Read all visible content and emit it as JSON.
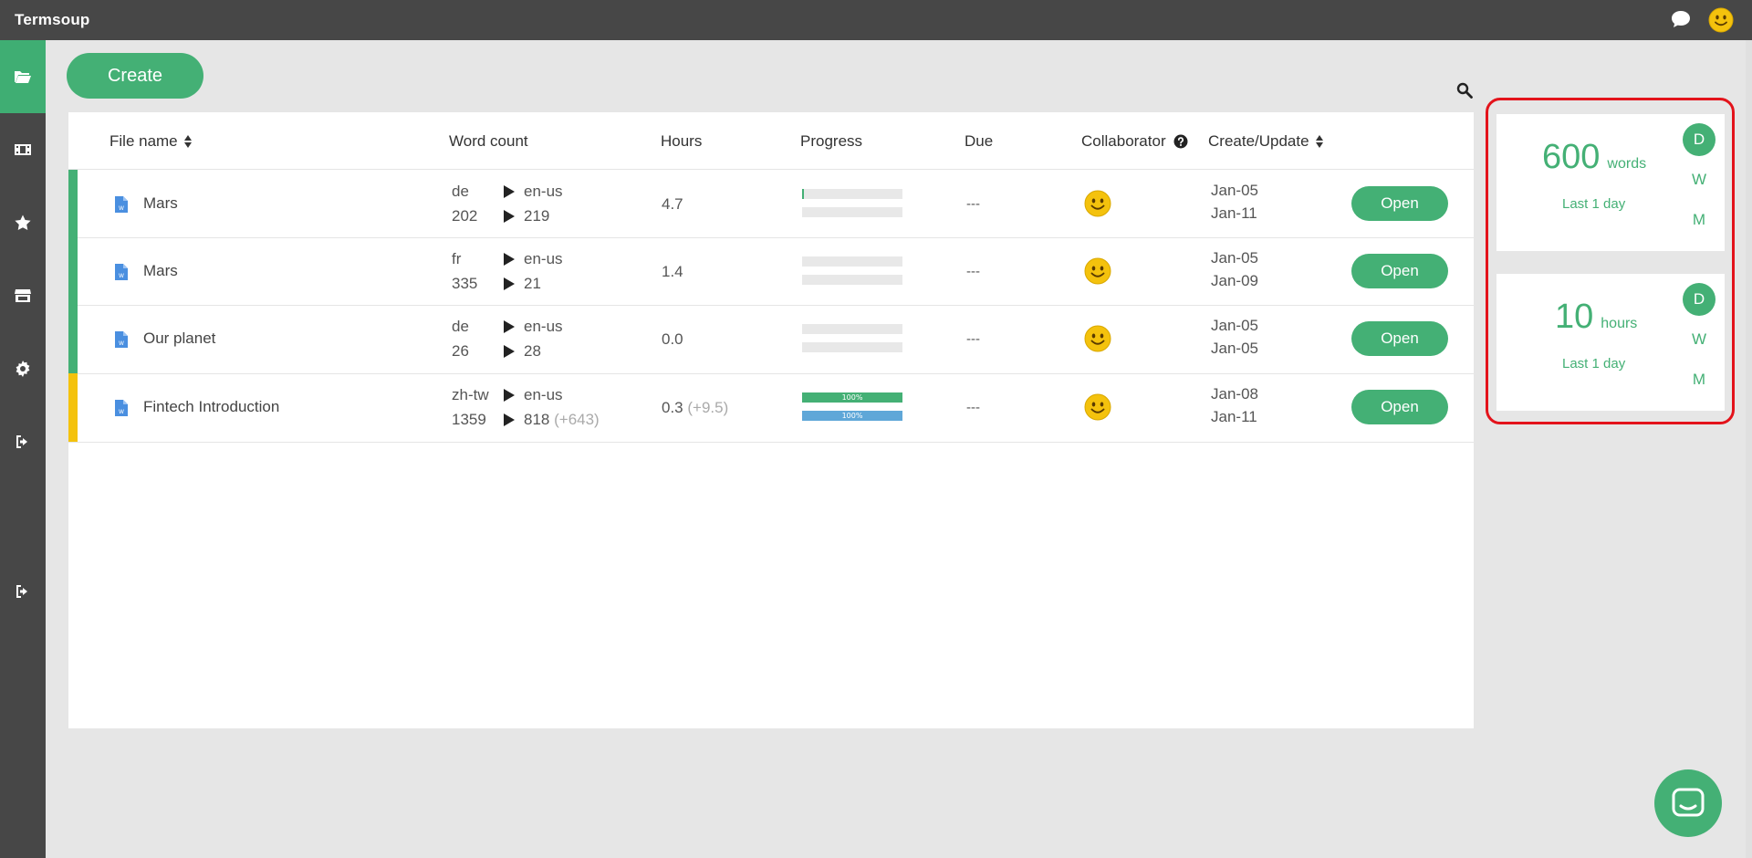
{
  "app": {
    "title": "Termsoup"
  },
  "colors": {
    "accent": "#44b075",
    "topbar": "#474747",
    "yellow_mark": "#f4c20d",
    "progress_blue": "#5fa7d8",
    "highlight": "#e3131b"
  },
  "topbar_icons": [
    "chat-bubble-icon",
    "smiley-avatar-icon"
  ],
  "sidebar": {
    "items": [
      {
        "name": "folder-open-icon",
        "active": true
      },
      {
        "name": "film-icon",
        "active": false
      },
      {
        "name": "star-icon",
        "active": false
      },
      {
        "name": "store-icon",
        "active": false
      },
      {
        "name": "gear-icon",
        "active": false
      },
      {
        "name": "sign-out-icon",
        "active": false
      },
      {
        "name": "sign-out-icon",
        "active": false
      }
    ]
  },
  "toolbar": {
    "create_label": "Create"
  },
  "table": {
    "headers": {
      "file_name": "File  name",
      "word_count": "Word  count",
      "hours": "Hours",
      "progress": "Progress",
      "due": "Due",
      "collaborator": "Collaborator",
      "create_update": "Create/Update"
    },
    "rows": [
      {
        "mark_color": "#44b075",
        "file_name": "Mars",
        "src_lang": "de",
        "src_words": "202",
        "tgt_lang": "en-us",
        "tgt_words": "219",
        "tgt_extra": "",
        "hours": "4.7",
        "hours_extra": "",
        "progress": [
          {
            "value": 2,
            "label": "2%"
          },
          {
            "value": 0,
            "label": "0%"
          }
        ],
        "due": "---",
        "created": "Jan-05",
        "updated": "Jan-11",
        "action": "Open"
      },
      {
        "mark_color": "#44b075",
        "file_name": "Mars",
        "src_lang": "fr",
        "src_words": "335",
        "tgt_lang": "en-us",
        "tgt_words": "21",
        "tgt_extra": "",
        "hours": "1.4",
        "hours_extra": "",
        "progress": [
          {
            "value": 0,
            "label": "0%"
          },
          {
            "value": 0,
            "label": "0%"
          }
        ],
        "due": "---",
        "created": "Jan-05",
        "updated": "Jan-09",
        "action": "Open"
      },
      {
        "mark_color": "#44b075",
        "file_name": "Our  planet",
        "src_lang": "de",
        "src_words": "26",
        "tgt_lang": "en-us",
        "tgt_words": "28",
        "tgt_extra": "",
        "hours": "0.0",
        "hours_extra": "",
        "progress": [
          {
            "value": 0,
            "label": "0%"
          },
          {
            "value": 0,
            "label": "0%"
          }
        ],
        "due": "---",
        "created": "Jan-05",
        "updated": "Jan-05",
        "action": "Open"
      },
      {
        "mark_color": "#f4c20d",
        "file_name": "Fintech Introduction",
        "src_lang": "zh-tw",
        "src_words": "1359",
        "tgt_lang": "en-us",
        "tgt_words": "818",
        "tgt_extra": "(+643)",
        "hours": "0.3",
        "hours_extra": "(+9.5)",
        "progress": [
          {
            "value": 100,
            "label": "100%"
          },
          {
            "value": 100,
            "label": "100%"
          }
        ],
        "due": "---",
        "created": "Jan-08",
        "updated": "Jan-11",
        "action": "Open"
      }
    ]
  },
  "stats": [
    {
      "value": "600",
      "unit": "words",
      "caption": "Last  1  day",
      "periods": [
        "D",
        "W",
        "M"
      ],
      "active_period": "D"
    },
    {
      "value": "10",
      "unit": "hours",
      "caption": "Last  1  day",
      "periods": [
        "D",
        "W",
        "M"
      ],
      "active_period": "D"
    }
  ]
}
